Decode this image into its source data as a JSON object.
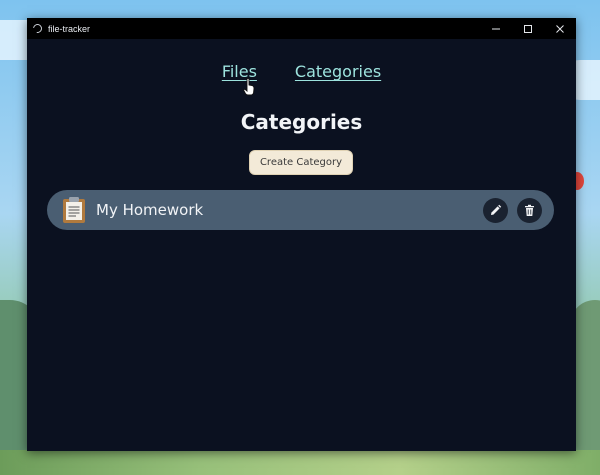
{
  "window": {
    "title": "file-tracker"
  },
  "nav": {
    "files_label": "Files",
    "categories_label": "Categories"
  },
  "page": {
    "title": "Categories",
    "create_button_label": "Create Category"
  },
  "categories": [
    {
      "name": "My Homework",
      "icon": "clipboard-icon"
    }
  ],
  "colors": {
    "window_bg": "#0b1120",
    "nav_link": "#9de3de",
    "row_bg": "#4a5e72",
    "button_bg": "#f3ead8"
  }
}
